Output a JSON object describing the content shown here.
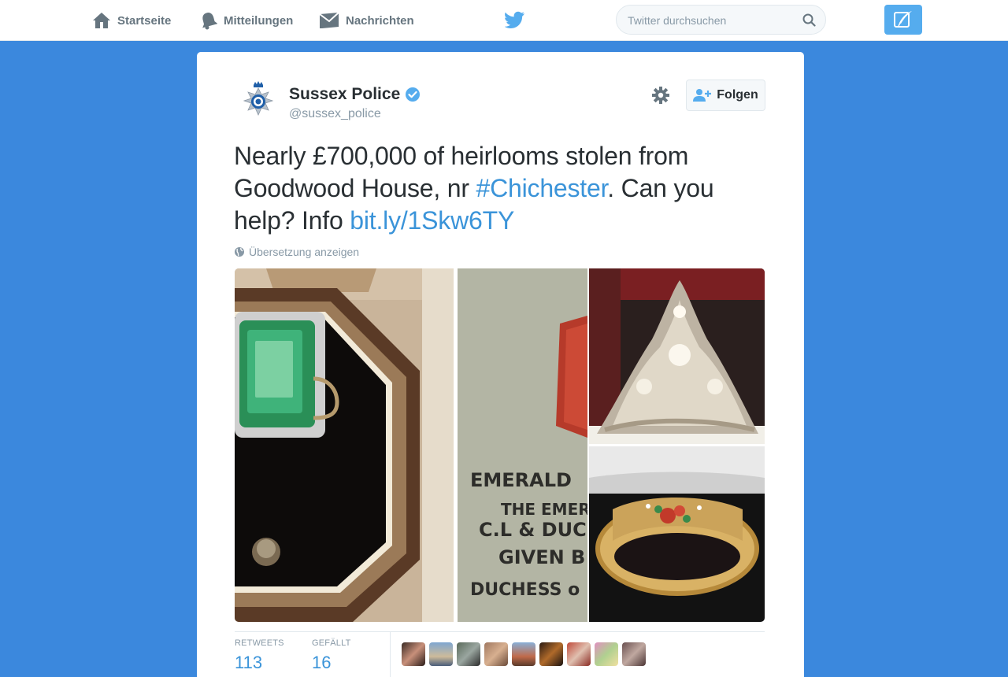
{
  "nav": {
    "home_label": "Startseite",
    "notifications_label": "Mitteilungen",
    "messages_label": "Nachrichten"
  },
  "search": {
    "placeholder": "Twitter durchsuchen"
  },
  "tweet": {
    "author_name": "Sussex Police",
    "author_handle": "@sussex_police",
    "follow_label": "Folgen",
    "text_part1": "Nearly £700,000 of heirlooms stolen from Goodwood House, nr ",
    "hashtag": "#Chichester",
    "text_part2": ". Can you help? Info ",
    "link": "bit.ly/1Skw6TY",
    "translate_label": "Übersetzung anzeigen",
    "photo_text": {
      "line1": "EMERALD",
      "line2": "THE EMER",
      "line3": "C.L & DUC",
      "line4": "GIVEN B",
      "line5": "DUCHESS o"
    }
  },
  "stats": {
    "retweets_label": "RETWEETS",
    "retweets_count": "113",
    "likes_label": "GEFÄLLT",
    "likes_count": "16"
  },
  "colors": {
    "background": "#3b88dd",
    "accent": "#55acee",
    "link": "#3b94d9",
    "verified": "#55acee"
  }
}
